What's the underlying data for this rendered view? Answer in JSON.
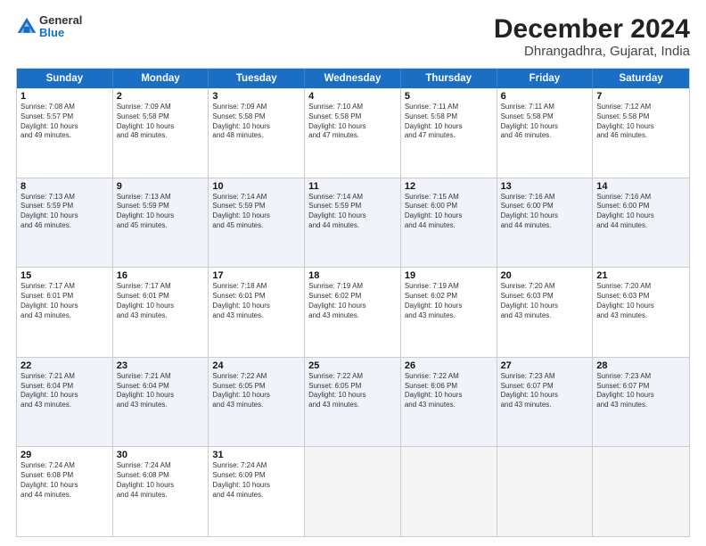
{
  "logo": {
    "general": "General",
    "blue": "Blue"
  },
  "title": "December 2024",
  "location": "Dhrangadhra, Gujarat, India",
  "headers": [
    "Sunday",
    "Monday",
    "Tuesday",
    "Wednesday",
    "Thursday",
    "Friday",
    "Saturday"
  ],
  "weeks": [
    [
      {
        "day": "1",
        "lines": [
          "Sunrise: 7:08 AM",
          "Sunset: 5:57 PM",
          "Daylight: 10 hours",
          "and 49 minutes."
        ]
      },
      {
        "day": "2",
        "lines": [
          "Sunrise: 7:09 AM",
          "Sunset: 5:58 PM",
          "Daylight: 10 hours",
          "and 48 minutes."
        ]
      },
      {
        "day": "3",
        "lines": [
          "Sunrise: 7:09 AM",
          "Sunset: 5:58 PM",
          "Daylight: 10 hours",
          "and 48 minutes."
        ]
      },
      {
        "day": "4",
        "lines": [
          "Sunrise: 7:10 AM",
          "Sunset: 5:58 PM",
          "Daylight: 10 hours",
          "and 47 minutes."
        ]
      },
      {
        "day": "5",
        "lines": [
          "Sunrise: 7:11 AM",
          "Sunset: 5:58 PM",
          "Daylight: 10 hours",
          "and 47 minutes."
        ]
      },
      {
        "day": "6",
        "lines": [
          "Sunrise: 7:11 AM",
          "Sunset: 5:58 PM",
          "Daylight: 10 hours",
          "and 46 minutes."
        ]
      },
      {
        "day": "7",
        "lines": [
          "Sunrise: 7:12 AM",
          "Sunset: 5:58 PM",
          "Daylight: 10 hours",
          "and 46 minutes."
        ]
      }
    ],
    [
      {
        "day": "8",
        "lines": [
          "Sunrise: 7:13 AM",
          "Sunset: 5:59 PM",
          "Daylight: 10 hours",
          "and 46 minutes."
        ]
      },
      {
        "day": "9",
        "lines": [
          "Sunrise: 7:13 AM",
          "Sunset: 5:59 PM",
          "Daylight: 10 hours",
          "and 45 minutes."
        ]
      },
      {
        "day": "10",
        "lines": [
          "Sunrise: 7:14 AM",
          "Sunset: 5:59 PM",
          "Daylight: 10 hours",
          "and 45 minutes."
        ]
      },
      {
        "day": "11",
        "lines": [
          "Sunrise: 7:14 AM",
          "Sunset: 5:59 PM",
          "Daylight: 10 hours",
          "and 44 minutes."
        ]
      },
      {
        "day": "12",
        "lines": [
          "Sunrise: 7:15 AM",
          "Sunset: 6:00 PM",
          "Daylight: 10 hours",
          "and 44 minutes."
        ]
      },
      {
        "day": "13",
        "lines": [
          "Sunrise: 7:16 AM",
          "Sunset: 6:00 PM",
          "Daylight: 10 hours",
          "and 44 minutes."
        ]
      },
      {
        "day": "14",
        "lines": [
          "Sunrise: 7:16 AM",
          "Sunset: 6:00 PM",
          "Daylight: 10 hours",
          "and 44 minutes."
        ]
      }
    ],
    [
      {
        "day": "15",
        "lines": [
          "Sunrise: 7:17 AM",
          "Sunset: 6:01 PM",
          "Daylight: 10 hours",
          "and 43 minutes."
        ]
      },
      {
        "day": "16",
        "lines": [
          "Sunrise: 7:17 AM",
          "Sunset: 6:01 PM",
          "Daylight: 10 hours",
          "and 43 minutes."
        ]
      },
      {
        "day": "17",
        "lines": [
          "Sunrise: 7:18 AM",
          "Sunset: 6:01 PM",
          "Daylight: 10 hours",
          "and 43 minutes."
        ]
      },
      {
        "day": "18",
        "lines": [
          "Sunrise: 7:19 AM",
          "Sunset: 6:02 PM",
          "Daylight: 10 hours",
          "and 43 minutes."
        ]
      },
      {
        "day": "19",
        "lines": [
          "Sunrise: 7:19 AM",
          "Sunset: 6:02 PM",
          "Daylight: 10 hours",
          "and 43 minutes."
        ]
      },
      {
        "day": "20",
        "lines": [
          "Sunrise: 7:20 AM",
          "Sunset: 6:03 PM",
          "Daylight: 10 hours",
          "and 43 minutes."
        ]
      },
      {
        "day": "21",
        "lines": [
          "Sunrise: 7:20 AM",
          "Sunset: 6:03 PM",
          "Daylight: 10 hours",
          "and 43 minutes."
        ]
      }
    ],
    [
      {
        "day": "22",
        "lines": [
          "Sunrise: 7:21 AM",
          "Sunset: 6:04 PM",
          "Daylight: 10 hours",
          "and 43 minutes."
        ]
      },
      {
        "day": "23",
        "lines": [
          "Sunrise: 7:21 AM",
          "Sunset: 6:04 PM",
          "Daylight: 10 hours",
          "and 43 minutes."
        ]
      },
      {
        "day": "24",
        "lines": [
          "Sunrise: 7:22 AM",
          "Sunset: 6:05 PM",
          "Daylight: 10 hours",
          "and 43 minutes."
        ]
      },
      {
        "day": "25",
        "lines": [
          "Sunrise: 7:22 AM",
          "Sunset: 6:05 PM",
          "Daylight: 10 hours",
          "and 43 minutes."
        ]
      },
      {
        "day": "26",
        "lines": [
          "Sunrise: 7:22 AM",
          "Sunset: 6:06 PM",
          "Daylight: 10 hours",
          "and 43 minutes."
        ]
      },
      {
        "day": "27",
        "lines": [
          "Sunrise: 7:23 AM",
          "Sunset: 6:07 PM",
          "Daylight: 10 hours",
          "and 43 minutes."
        ]
      },
      {
        "day": "28",
        "lines": [
          "Sunrise: 7:23 AM",
          "Sunset: 6:07 PM",
          "Daylight: 10 hours",
          "and 43 minutes."
        ]
      }
    ],
    [
      {
        "day": "29",
        "lines": [
          "Sunrise: 7:24 AM",
          "Sunset: 6:08 PM",
          "Daylight: 10 hours",
          "and 44 minutes."
        ]
      },
      {
        "day": "30",
        "lines": [
          "Sunrise: 7:24 AM",
          "Sunset: 6:08 PM",
          "Daylight: 10 hours",
          "and 44 minutes."
        ]
      },
      {
        "day": "31",
        "lines": [
          "Sunrise: 7:24 AM",
          "Sunset: 6:09 PM",
          "Daylight: 10 hours",
          "and 44 minutes."
        ]
      },
      {
        "day": "",
        "lines": []
      },
      {
        "day": "",
        "lines": []
      },
      {
        "day": "",
        "lines": []
      },
      {
        "day": "",
        "lines": []
      }
    ]
  ]
}
